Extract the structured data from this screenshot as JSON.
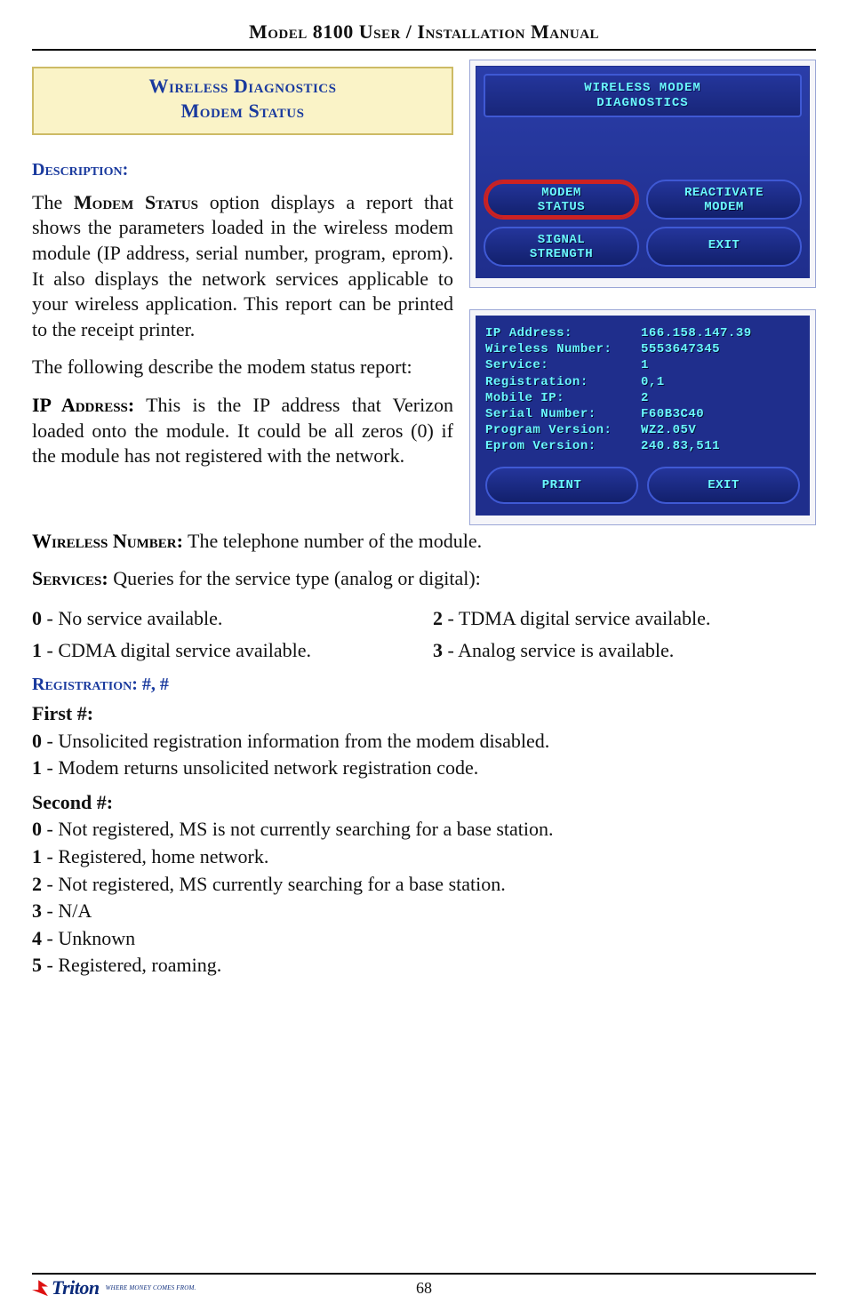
{
  "header": {
    "title": "Model 8100 User / Installation Manual"
  },
  "gold_box": {
    "line1": "Wireless Diagnostics",
    "line2": "Modem Status"
  },
  "desc_label": "Description:",
  "para1_pre": "The ",
  "para1_sc": "Modem Status",
  "para1_post": " option displays a report that shows the parameters loaded in the wireless modem module (IP address, serial number, program, eprom). It also displays the network services applicable to your wireless application. This report can be printed to the receipt printer.",
  "para2": "The following describe the modem status report:",
  "ip_sc": "IP Address:",
  "ip_text": "  This is the IP address that Verizon loaded onto the module. It could be all zeros (0) if the module has not registered with the network.",
  "wireless_sc": "Wireless Number:",
  "wireless_text": "  The telephone number of the module.",
  "services_sc": "Services:",
  "services_text": "  Queries for the service type (analog or digital):",
  "svc": {
    "l0b": "0",
    "l0t": " - No service available.",
    "l2b": "2",
    "l2t": " - TDMA digital service available.",
    "l1b": "1",
    "l1t": " - CDMA digital service available.",
    "l3b": "3",
    "l3t": " - Analog service is available."
  },
  "reg_sc": "Registration:  #, #",
  "first_h": "First #:",
  "reg_first": {
    "a_b": "0",
    "a_t": " - Unsolicited registration information from the modem disabled.",
    "b_b": "1",
    "b_t": " - Modem returns unsolicited network registration code."
  },
  "second_h": "Second #:",
  "reg_second": {
    "a_b": "0",
    "a_t": " - Not registered, MS is not currently searching for a base station.",
    "b_b": "1",
    "b_t": " - Registered, home network.",
    "c_b": "2",
    "c_t": " - Not registered, MS currently searching for a base station.",
    "d_b": "3",
    "d_t": " - N/A",
    "e_b": "4",
    "e_t": " - Unknown",
    "f_b": "5",
    "f_t": " - Registered, roaming."
  },
  "diag_menu": {
    "title_l1": "WIRELESS MODEM",
    "title_l2": "DIAGNOSTICS",
    "btn_modem_status": "MODEM\nSTATUS",
    "btn_reactivate": "REACTIVATE\nMODEM",
    "btn_signal": "SIGNAL\nSTRENGTH",
    "btn_exit": "EXIT"
  },
  "status": {
    "rows": [
      {
        "k": "IP Address:",
        "v": "166.158.147.39"
      },
      {
        "k": "Wireless Number:",
        "v": "5553647345"
      },
      {
        "k": "Service:",
        "v": "1"
      },
      {
        "k": "Registration:",
        "v": "0,1"
      },
      {
        "k": "Mobile IP:",
        "v": "2"
      },
      {
        "k": "Serial Number:",
        "v": "F60B3C40"
      },
      {
        "k": "Program Version:",
        "v": "WZ2.05V"
      },
      {
        "k": "Eprom Version:",
        "v": "240.83,511"
      }
    ],
    "btn_print": "PRINT",
    "btn_exit": "EXIT"
  },
  "footer": {
    "brand": "Triton",
    "tag": "Where Money Comes From.",
    "page": "68"
  }
}
